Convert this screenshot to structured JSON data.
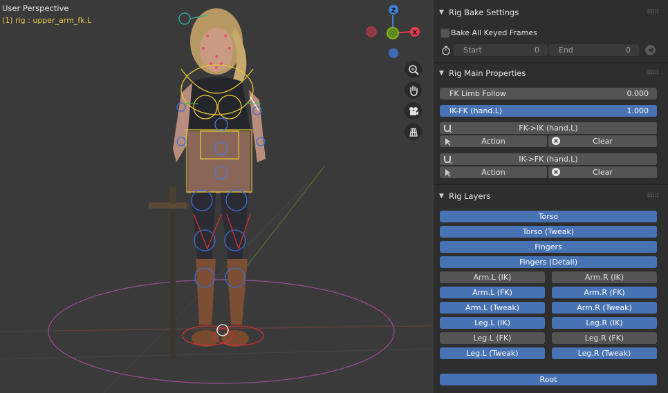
{
  "viewport": {
    "title": "User Perspective",
    "subtitle": "(1) rig : upper_arm_fk.L",
    "gizmo": {
      "z_label": "Z",
      "x_label": "X",
      "colors": {
        "x": "#e23d4f",
        "y": "#86b61a",
        "z": "#3d82d4"
      }
    },
    "nav_buttons": [
      "zoom-icon",
      "hand-icon",
      "camera-icon",
      "grid-icon"
    ]
  },
  "panel": {
    "bake": {
      "title": "Rig Bake Settings",
      "bake_all_label": "Bake All Keyed Frames",
      "start_label": "Start",
      "start_value": "0",
      "end_label": "End",
      "end_value": "0"
    },
    "main": {
      "title": "Rig Main Properties",
      "fk_follow_label": "FK Limb Follow",
      "fk_follow_value": "0.000",
      "ikfk_label": "IK-FK (hand.L)",
      "ikfk_value": "1.000",
      "fk_to_ik_label": "FK->IK (hand.L)",
      "ik_to_fk_label": "IK->FK (hand.L)",
      "action_label": "Action",
      "clear_label": "Clear"
    },
    "layers": {
      "title": "Rig Layers",
      "full": [
        {
          "label": "Torso",
          "on": true
        },
        {
          "label": "Torso (Tweak)",
          "on": true
        },
        {
          "label": "Fingers",
          "on": true
        },
        {
          "label": "Fingers (Detail)",
          "on": true
        }
      ],
      "pairs": [
        [
          {
            "label": "Arm.L (IK)",
            "on": false
          },
          {
            "label": "Arm.R (IK)",
            "on": false
          }
        ],
        [
          {
            "label": "Arm.L (FK)",
            "on": true
          },
          {
            "label": "Arm.R (FK)",
            "on": true
          }
        ],
        [
          {
            "label": "Arm.L (Tweak)",
            "on": true
          },
          {
            "label": "Arm.R (Tweak)",
            "on": true
          }
        ],
        [
          {
            "label": "Leg.L (IK)",
            "on": true
          },
          {
            "label": "Leg.R (IK)",
            "on": true
          }
        ],
        [
          {
            "label": "Leg.L (FK)",
            "on": false
          },
          {
            "label": "Leg.R (FK)",
            "on": false
          }
        ],
        [
          {
            "label": "Leg.L (Tweak)",
            "on": true
          },
          {
            "label": "Leg.R (Tweak)",
            "on": true
          }
        ]
      ],
      "root": {
        "label": "Root",
        "on": true
      }
    }
  }
}
